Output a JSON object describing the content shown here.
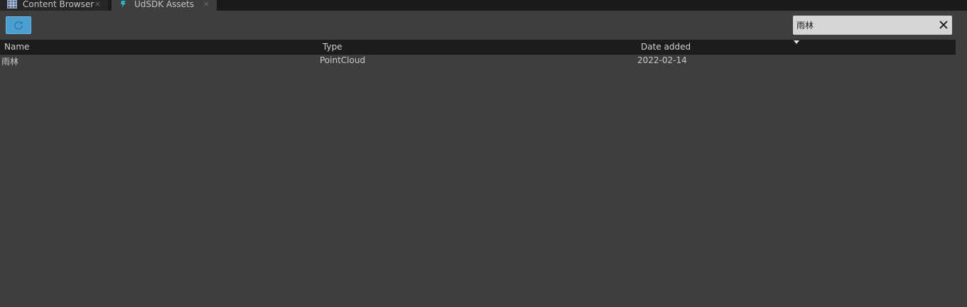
{
  "tabs": [
    {
      "label": "Content Browser",
      "close": "×",
      "icon": "content-browser-icon"
    },
    {
      "label": "UdSDK Assets",
      "close": "×",
      "icon": "udsdk-icon"
    }
  ],
  "toolbar": {
    "refresh_icon": "refresh-icon",
    "refresh_color": "#4b9fd0"
  },
  "search": {
    "value": "雨林",
    "clear_icon": "close-icon"
  },
  "table": {
    "columns": [
      "Name",
      "Type",
      "Date added"
    ],
    "sort_column": "Date added",
    "rows": [
      {
        "name": "雨林",
        "type": "PointCloud",
        "date_added": "2022-02-14"
      }
    ]
  }
}
